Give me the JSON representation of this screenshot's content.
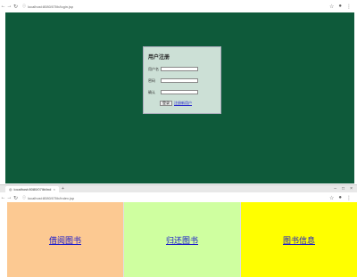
{
  "top_window": {
    "url": "localhost:8080/07lib/login.jsp",
    "page_bg": "#0e5a3a",
    "login": {
      "title": "用户注册",
      "username_label": "用户名",
      "password_label": "密码",
      "confirm_label": "确认",
      "login_button": "登录",
      "register_link": "注册新用户"
    }
  },
  "bottom_window": {
    "tab_title": "localhost:8080/07lib/ind",
    "url": "localhost:8080/07lib/index.jsp",
    "panels": [
      {
        "label": "借阅图书",
        "color": "#fcc992"
      },
      {
        "label": "归还图书",
        "color": "#cfffa0"
      },
      {
        "label": "图书信息",
        "color": "#ffff00"
      }
    ]
  }
}
